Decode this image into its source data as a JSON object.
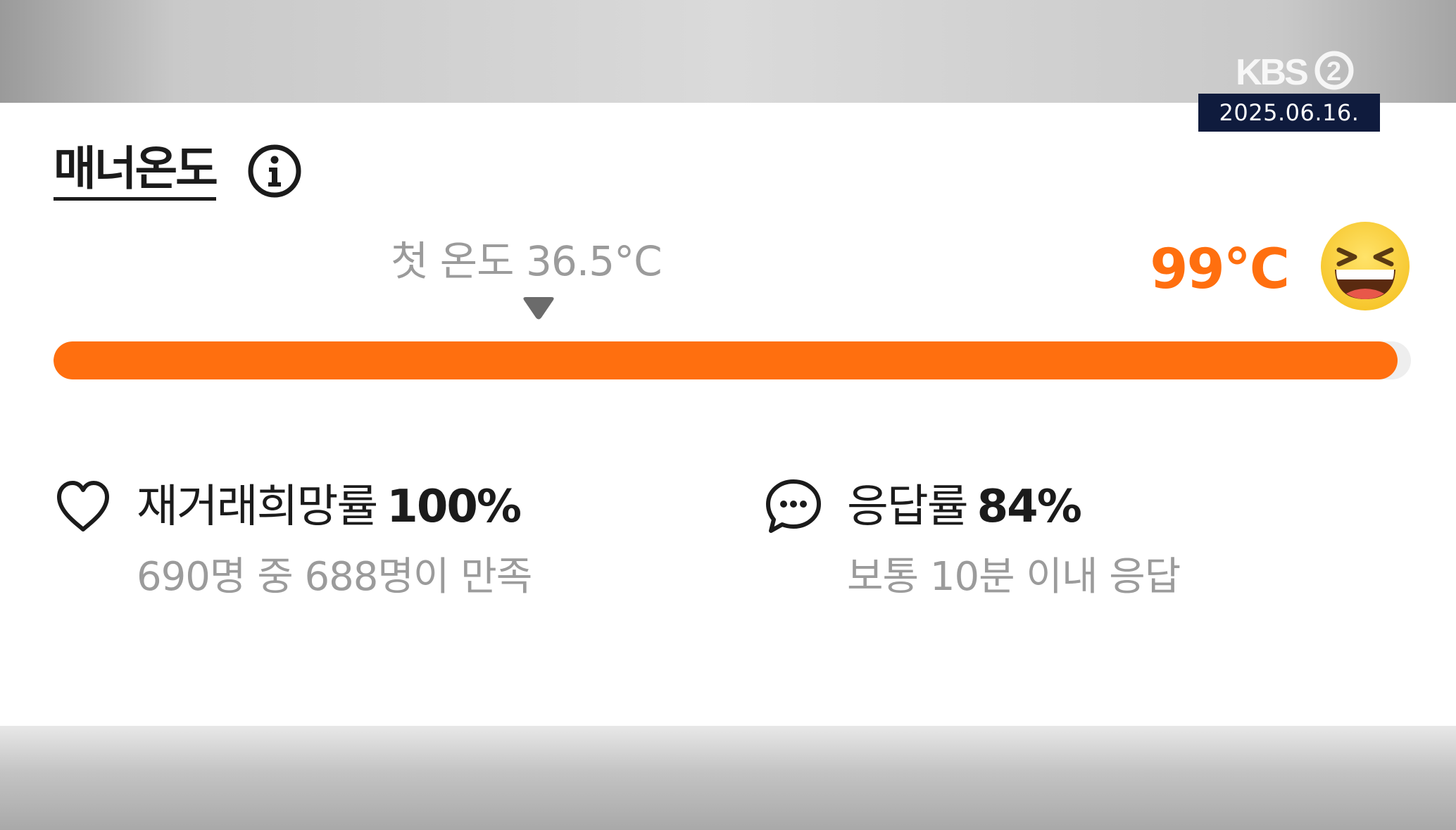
{
  "broadcast": {
    "logo_text": "KBS2",
    "date": "2025.06.16."
  },
  "manner": {
    "title": "매너온도",
    "info_icon": "info-circle-icon",
    "first_temp_label": "첫 온도 36.5°C",
    "temperature": "99°C",
    "temperature_fraction": 0.99,
    "face_icon": "grinning-squinting-face-icon",
    "accent_color": "#ff6f0f"
  },
  "stats": [
    {
      "icon": "heart-icon",
      "label": "재거래희망률",
      "value": "100%",
      "detail": "690명 중 688명이 만족"
    },
    {
      "icon": "chat-bubble-icon",
      "label": "응답률",
      "value": "84%",
      "detail": "보통 10분 이내 응답"
    }
  ]
}
